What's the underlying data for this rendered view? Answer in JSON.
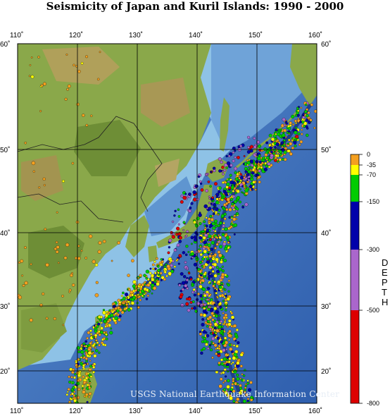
{
  "title": "Seismicity of Japan and Kuril Islands: 1990 - 2000",
  "credit": "USGS National Earthquake Information Center",
  "axes": {
    "lon_labels": [
      "110˚",
      "120˚",
      "130˚",
      "140˚",
      "150˚",
      "160˚"
    ],
    "lat_labels": [
      "60˚",
      "50˚",
      "40˚",
      "30˚",
      "20˚"
    ]
  },
  "legend": {
    "title_letters": [
      "D",
      "E",
      "P",
      "T",
      "H"
    ],
    "depth_labels": [
      "0",
      "-35",
      "-70",
      "-150",
      "-300",
      "-500",
      "-800"
    ],
    "colors": {
      "0 to 35 km": "#f4a020",
      "35 to 70 km": "#ffff00",
      "70 to 150 km": "#00cc00",
      "150 to 300 km": "#0000aa",
      "300 to 500 km": "#aa66cc",
      "500 to 800 km": "#dd0000"
    }
  },
  "colors": {
    "land": "#8aa84a",
    "lowland": "#6e8e36",
    "highland": "#b0a05a",
    "ocean": "#3c6fb8",
    "shallow_sea": "#8ec2e6",
    "trench": "#1f3f8a",
    "grid": "#000000"
  }
}
